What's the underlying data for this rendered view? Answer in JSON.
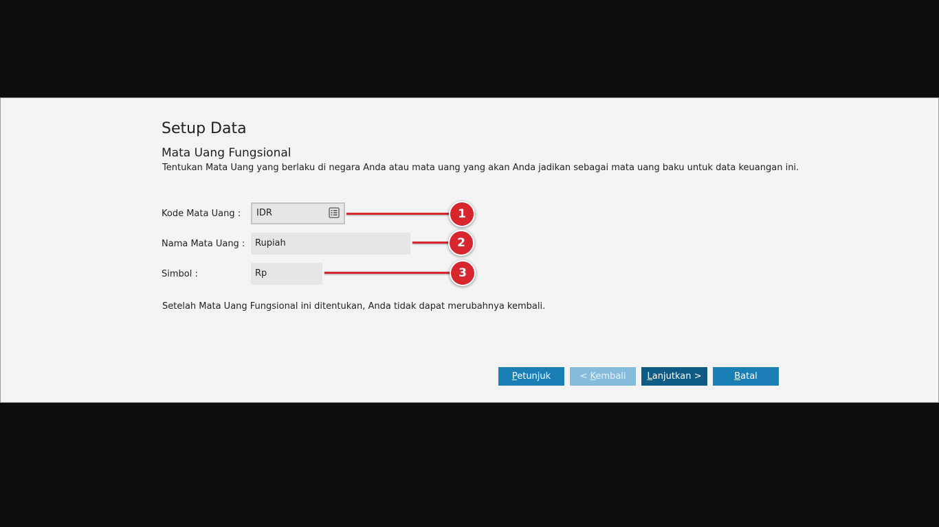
{
  "dialog": {
    "title": "Setup Data",
    "subtitle": "Mata Uang Fungsional",
    "description": "Tentukan Mata Uang yang berlaku di negara Anda atau mata uang yang akan Anda jadikan sebagai mata uang baku untuk data keuangan ini.",
    "note": "Setelah Mata Uang Fungsional ini ditentukan, Anda tidak dapat merubahnya kembali."
  },
  "form": {
    "kode_label": "Kode Mata Uang :",
    "kode_value": "IDR",
    "kode_icon": "list-lookup-icon",
    "nama_label": "Nama Mata Uang :",
    "nama_value": "Rupiah",
    "simbol_label": "Simbol :",
    "simbol_value": "Rp"
  },
  "callouts": [
    "1",
    "2",
    "3"
  ],
  "buttons": {
    "petunjuk_hotkey": "P",
    "petunjuk_rest": "etunjuk",
    "kembali_prefix": "< ",
    "kembali_hotkey": "K",
    "kembali_rest": "embali",
    "lanjutkan_hotkey": "L",
    "lanjutkan_rest": "anjutkan >",
    "batal_hotkey": "B",
    "batal_rest": "atal"
  },
  "colors": {
    "accent": "#1a7fb5",
    "accent_dark": "#0e5b86",
    "disabled": "#86bcdb",
    "callout": "#d8262f",
    "background": "#f4f4f4"
  }
}
